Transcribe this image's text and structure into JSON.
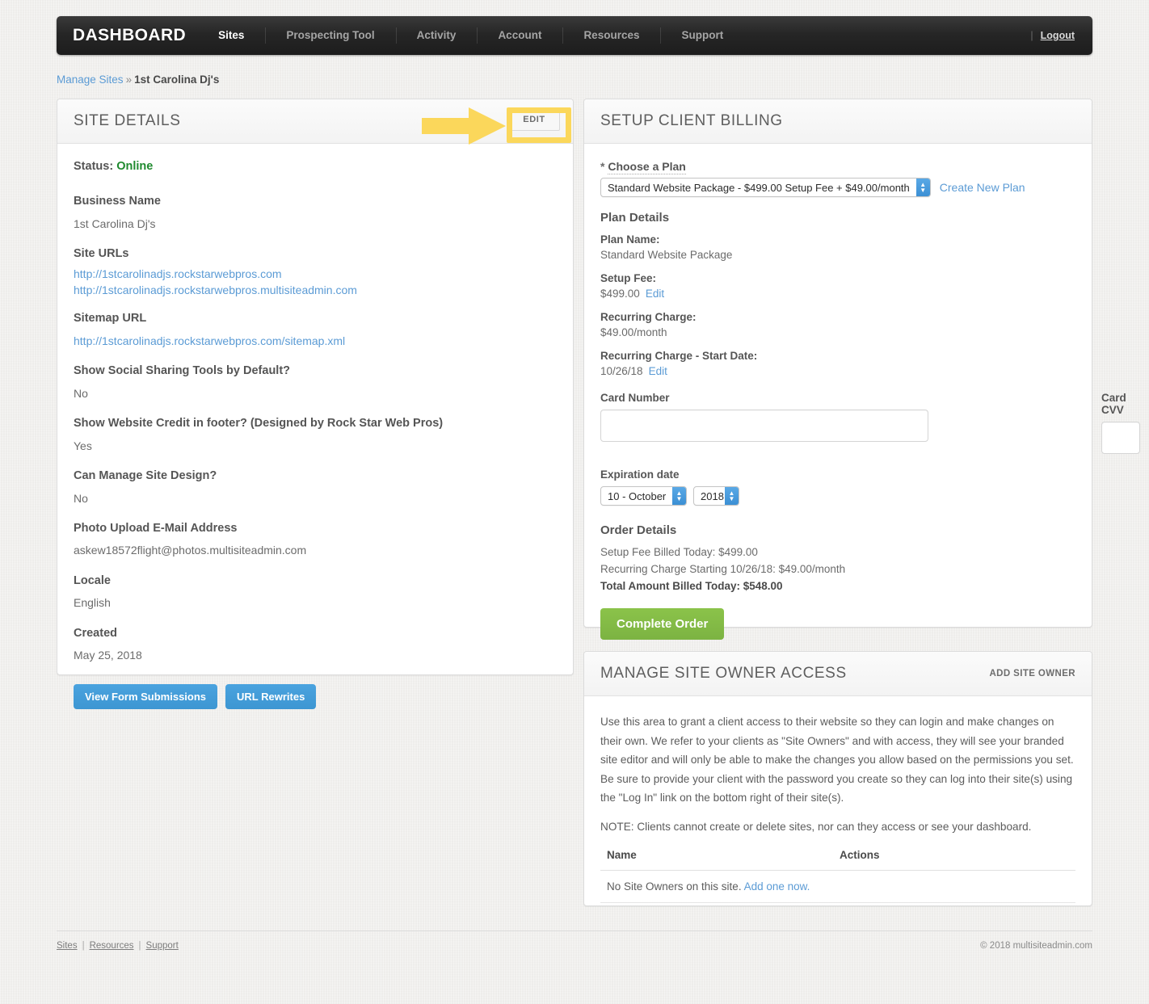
{
  "nav": {
    "brand": "DASHBOARD",
    "items": [
      {
        "label": "Sites",
        "active": true
      },
      {
        "label": "Prospecting Tool",
        "active": false
      },
      {
        "label": "Activity",
        "active": false
      },
      {
        "label": "Account",
        "active": false
      },
      {
        "label": "Resources",
        "active": false
      },
      {
        "label": "Support",
        "active": false
      }
    ],
    "separator": "|",
    "logout": "Logout"
  },
  "breadcrumb": {
    "parent": "Manage Sites",
    "separator": "»",
    "current": "1st Carolina Dj's"
  },
  "site_details": {
    "title": "SITE DETAILS",
    "edit_label": "EDIT",
    "status_label": "Status:",
    "status_value": "Online",
    "status_color": "#1f8a2f",
    "fields": [
      {
        "label": "Business Name",
        "value": "1st Carolina Dj's"
      },
      {
        "label": "Sitemap URL",
        "value": "http://1stcarolinadjs.rockstarwebpros.com/sitemap.xml"
      },
      {
        "label": "Show Social Sharing Tools by Default?",
        "value": "No"
      },
      {
        "label": "Show Website Credit in footer? (Designed by Rock Star Web Pros)",
        "value": "Yes"
      },
      {
        "label": "Can Manage Site Design?",
        "value": "No"
      },
      {
        "label": "Photo Upload E-Mail Address",
        "value": "askew18572flight@photos.multisiteadmin.com"
      },
      {
        "label": "Locale",
        "value": "English"
      },
      {
        "label": "Created",
        "value": "May 25, 2018"
      }
    ],
    "site_urls_label": "Site URLs",
    "site_urls": [
      "http://1stcarolinadjs.rockstarwebpros.com",
      "http://1stcarolinadjs.rockstarwebpros.multisiteadmin.com"
    ],
    "buttons": [
      {
        "label": "View Form Submissions"
      },
      {
        "label": "URL Rewrites"
      }
    ],
    "annotation_color": "#fbd75b"
  },
  "billing": {
    "title": "SETUP CLIENT BILLING",
    "choose_plan_star": "*",
    "choose_plan_label": "Choose a Plan",
    "plan_selected": "Standard Website Package - $499.00 Setup Fee + $49.00/month",
    "create_new_plan": "Create New Plan",
    "plan_details_heading": "Plan Details",
    "plan_name_label": "Plan Name:",
    "plan_name_value": "Standard Website Package",
    "setup_fee_label": "Setup Fee:",
    "setup_fee_value": "$499.00",
    "setup_fee_edit": "Edit",
    "recurring_label": "Recurring Charge:",
    "recurring_value": "$49.00/month",
    "start_date_label": "Recurring Charge - Start Date:",
    "start_date_value": "10/26/18",
    "start_date_edit": "Edit",
    "card_number_label": "Card Number",
    "card_number_value": "",
    "card_cvv_label": "Card CVV",
    "card_cvv_value": "",
    "expiration_label": "Expiration date",
    "exp_month": "10 - October",
    "exp_year": "2018",
    "order_heading": "Order Details",
    "order_lines": [
      "Setup Fee Billed Today: $499.00",
      "Recurring Charge Starting 10/26/18: $49.00/month"
    ],
    "order_total": "Total Amount Billed Today: $548.00",
    "complete_order": "Complete Order",
    "accent_green": "#8bc34a",
    "accent_blue": "#5b9bd5"
  },
  "owner_access": {
    "title": "MANAGE SITE OWNER ACCESS",
    "add_label": "ADD SITE OWNER",
    "paragraph": "Use this area to grant a client access to their website so they can login and make changes on their own. We refer to your clients as \"Site Owners\" and with access, they will see your branded site editor and will only be able to make the changes you allow based on the permissions you set. Be sure to provide your client with the password you create so they can log into their site(s) using the \"Log In\" link on the bottom right of their site(s).",
    "note": "NOTE: Clients cannot create or delete sites, nor can they access or see your dashboard.",
    "columns": [
      "Name",
      "Actions"
    ],
    "empty_text": "No Site Owners on this site.",
    "empty_link": "Add one now."
  },
  "footer": {
    "links": [
      "Sites",
      "Resources",
      "Support"
    ],
    "separator": "|",
    "copyright": "© 2018 multisiteadmin.com"
  }
}
